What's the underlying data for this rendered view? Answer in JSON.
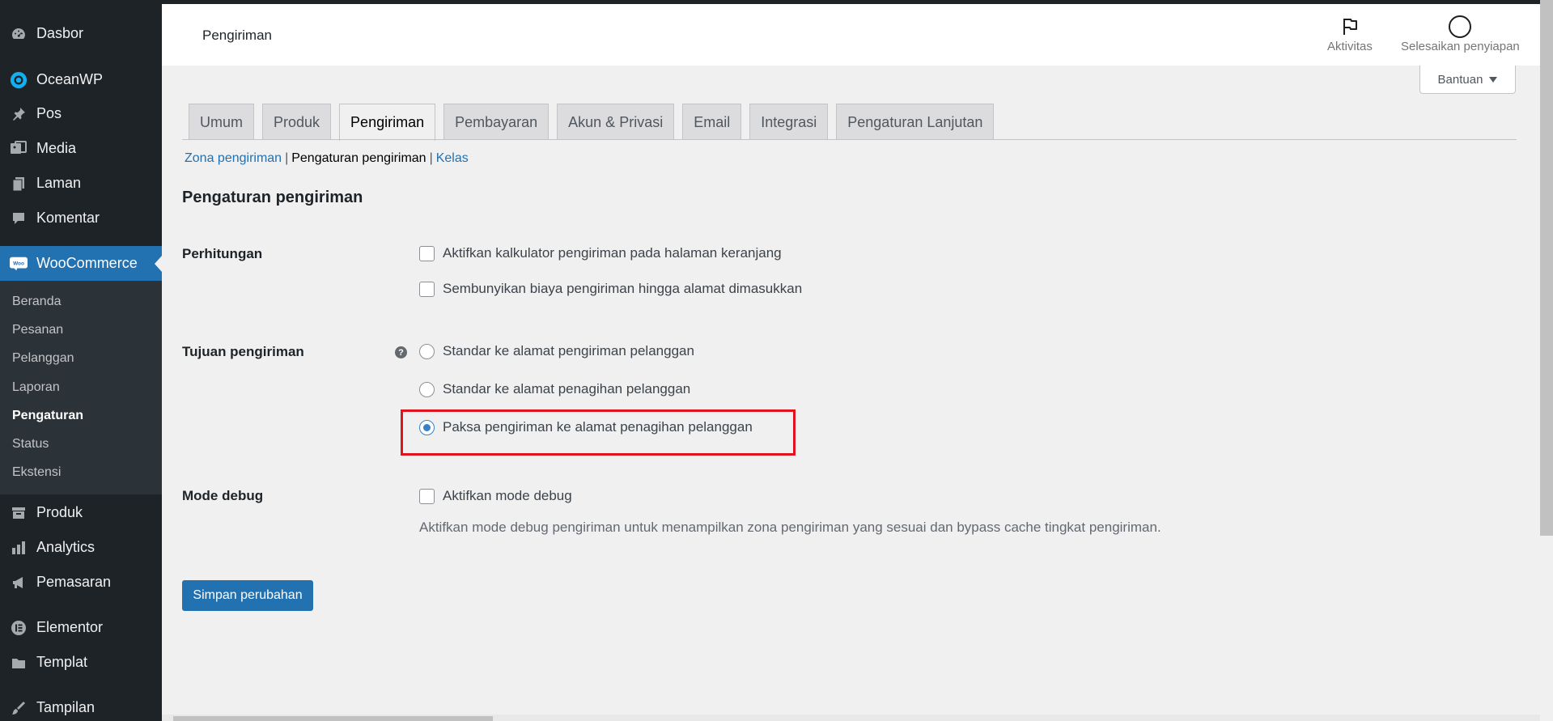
{
  "sidebar": {
    "items": [
      {
        "label": "Dasbor",
        "icon": "dashboard-icon"
      },
      {
        "label": "OceanWP",
        "icon": "oceanwp-icon"
      },
      {
        "label": "Pos",
        "icon": "pin-icon"
      },
      {
        "label": "Media",
        "icon": "media-icon"
      },
      {
        "label": "Laman",
        "icon": "pages-icon"
      },
      {
        "label": "Komentar",
        "icon": "comment-icon"
      },
      {
        "label": "WooCommerce",
        "icon": "woocommerce-icon"
      },
      {
        "label": "Produk",
        "icon": "archive-icon"
      },
      {
        "label": "Analytics",
        "icon": "bar-chart-icon"
      },
      {
        "label": "Pemasaran",
        "icon": "megaphone-icon"
      },
      {
        "label": "Elementor",
        "icon": "elementor-icon"
      },
      {
        "label": "Templat",
        "icon": "folder-icon"
      },
      {
        "label": "Tampilan",
        "icon": "brush-icon"
      }
    ],
    "woo_submenu": [
      "Beranda",
      "Pesanan",
      "Pelanggan",
      "Laporan",
      "Pengaturan",
      "Status",
      "Ekstensi"
    ],
    "woo_badge": "Woo"
  },
  "header": {
    "title": "Pengiriman",
    "activity_label": "Aktivitas",
    "setup_label": "Selesaikan penyiapan",
    "help_label": "Bantuan"
  },
  "tabs": [
    "Umum",
    "Produk",
    "Pengiriman",
    "Pembayaran",
    "Akun & Privasi",
    "Email",
    "Integrasi",
    "Pengaturan Lanjutan"
  ],
  "subsub": {
    "zones": "Zona pengiriman",
    "options": "Pengaturan pengiriman",
    "classes": "Kelas",
    "separator": "|"
  },
  "section_title": "Pengaturan pengiriman",
  "calculations": {
    "label": "Perhitungan",
    "options": [
      "Aktifkan kalkulator pengiriman pada halaman keranjang",
      "Sembunyikan biaya pengiriman hingga alamat dimasukkan"
    ]
  },
  "destination": {
    "label": "Tujuan pengiriman",
    "help": "?",
    "options": [
      "Standar ke alamat pengiriman pelanggan",
      "Standar ke alamat penagihan pelanggan",
      "Paksa pengiriman ke alamat penagihan pelanggan"
    ],
    "selected_index": 2
  },
  "debug": {
    "label": "Mode debug",
    "option": "Aktifkan mode debug",
    "description": "Aktifkan mode debug pengiriman untuk menampilkan zona pengiriman yang sesuai dan bypass cache tingkat pengiriman."
  },
  "save_label": "Simpan perubahan",
  "colors": {
    "accent": "#2271b1",
    "sidebar": "#1d2327",
    "highlight": "#e0141e"
  }
}
